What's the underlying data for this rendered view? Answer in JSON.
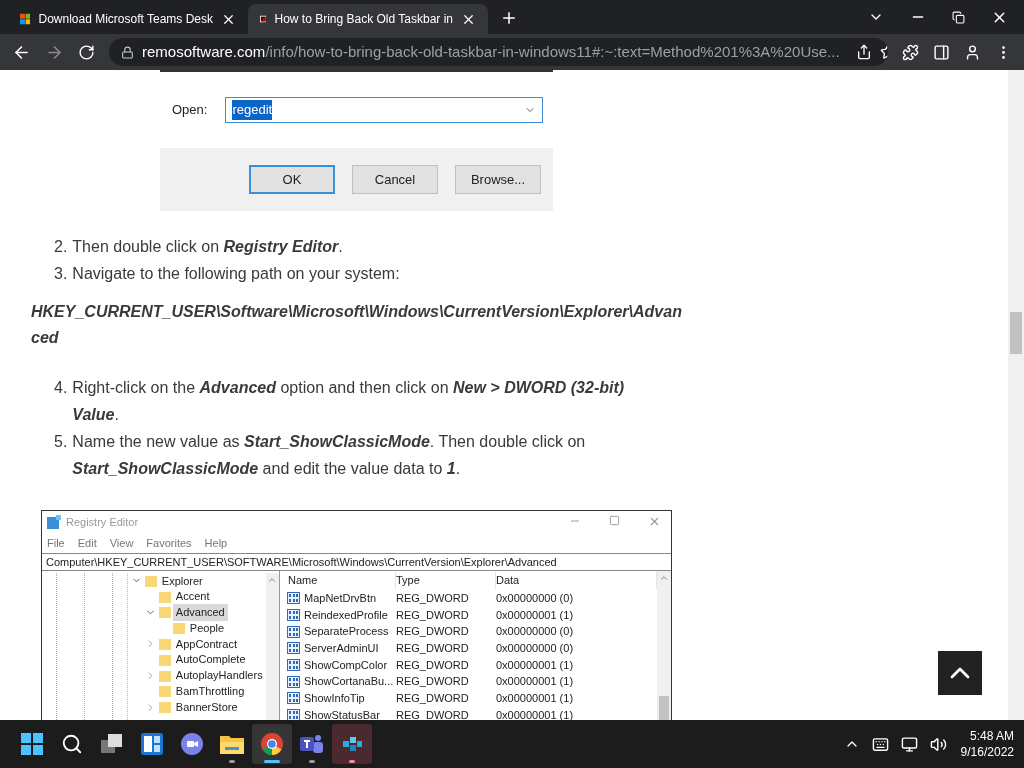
{
  "browser": {
    "tabs": [
      {
        "title": "Download Microsoft Teams Desk",
        "selected": false
      },
      {
        "title": "How to Bring Back Old Taskbar in",
        "selected": true
      }
    ],
    "address": {
      "domain": "remosoftware.com",
      "path": "/info/how-to-bring-back-old-taskbar-in-windows11#:~:text=Method%201%3A%20Use..."
    }
  },
  "article": {
    "run_dialog": {
      "label": "Open:",
      "value": "regedit",
      "buttons": [
        {
          "label": "OK",
          "selected": true
        },
        {
          "label": "Cancel",
          "selected": false
        },
        {
          "label": "Browse...",
          "selected": false
        }
      ]
    },
    "steps_a": [
      {
        "number": "2.",
        "text": "Then double click on **Registry Editor**."
      },
      {
        "number": "3.",
        "text": "Navigate to the following path on your system:"
      }
    ],
    "path": "HKEY_CURRENT_USER\\Software\\Microsoft\\Windows\\CurrentVersion\\Explorer\\Advanced",
    "steps_b": [
      {
        "number": "4.",
        "text": "Right-click on the **Advanced** option and then click on **New > DWORD (32-bit) Value**."
      },
      {
        "number": "5.",
        "text": "Name the new value as **Start_ShowClassicMode**. Then double click on **Start_ShowClassicMode** and edit the value data to **1**."
      }
    ],
    "registry": {
      "title": "Registry Editor",
      "menu": [
        "File",
        "Edit",
        "View",
        "Favorites",
        "Help"
      ],
      "address": "Computer\\HKEY_CURRENT_USER\\SOFTWARE\\Microsoft\\Windows\\CurrentVersion\\Explorer\\Advanced",
      "tree": [
        {
          "label": "Explorer",
          "expandable": true,
          "expanded": true,
          "selected": false,
          "children": [
            {
              "label": "Accent",
              "expandable": false,
              "expanded": false,
              "selected": false
            },
            {
              "label": "Advanced",
              "expandable": true,
              "expanded": true,
              "selected": true,
              "children": [
                {
                  "label": "People",
                  "expandable": false,
                  "expanded": false,
                  "selected": false
                }
              ]
            },
            {
              "label": "AppContract",
              "expandable": true,
              "expanded": false,
              "selected": false
            },
            {
              "label": "AutoComplete",
              "expandable": false,
              "expanded": false,
              "selected": false
            },
            {
              "label": "AutoplayHandlers",
              "expandable": true,
              "expanded": false,
              "selected": false
            },
            {
              "label": "BamThrottling",
              "expandable": false,
              "expanded": false,
              "selected": false
            },
            {
              "label": "BannerStore",
              "expandable": true,
              "expanded": false,
              "selected": false
            }
          ]
        }
      ],
      "columns": [
        "Name",
        "Type",
        "Data"
      ],
      "values": [
        {
          "name": "MapNetDrvBtn",
          "type": "REG_DWORD",
          "data": "0x00000000 (0)"
        },
        {
          "name": "ReindexedProfile",
          "type": "REG_DWORD",
          "data": "0x00000001 (1)"
        },
        {
          "name": "SeparateProcess",
          "type": "REG_DWORD",
          "data": "0x00000000 (0)"
        },
        {
          "name": "ServerAdminUI",
          "type": "REG_DWORD",
          "data": "0x00000000 (0)"
        },
        {
          "name": "ShowCompColor",
          "type": "REG_DWORD",
          "data": "0x00000001 (1)"
        },
        {
          "name": "ShowCortanaBu...",
          "type": "REG_DWORD",
          "data": "0x00000001 (1)"
        },
        {
          "name": "ShowInfoTip",
          "type": "REG_DWORD",
          "data": "0x00000001 (1)"
        },
        {
          "name": "ShowStatusBar",
          "type": "REG_DWORD",
          "data": "0x00000001 (1)"
        }
      ]
    }
  },
  "taskbar": {
    "apps": [
      {
        "kind": "start",
        "running": false,
        "selected": false,
        "flashing": false
      },
      {
        "kind": "search",
        "running": false,
        "selected": false,
        "flashing": false
      },
      {
        "kind": "taskview",
        "running": false,
        "selected": false,
        "flashing": false
      },
      {
        "kind": "widgets",
        "running": false,
        "selected": false,
        "flashing": false
      },
      {
        "kind": "chat",
        "running": false,
        "selected": false,
        "flashing": false
      },
      {
        "kind": "files",
        "running": true,
        "selected": false,
        "flashing": false
      },
      {
        "kind": "browser",
        "running": true,
        "selected": true,
        "flashing": false
      },
      {
        "kind": "teams",
        "running": true,
        "selected": false,
        "flashing": false
      },
      {
        "kind": "cube",
        "running": true,
        "selected": false,
        "flashing": true
      }
    ],
    "time": "5:48 AM",
    "date": "9/16/2022"
  }
}
